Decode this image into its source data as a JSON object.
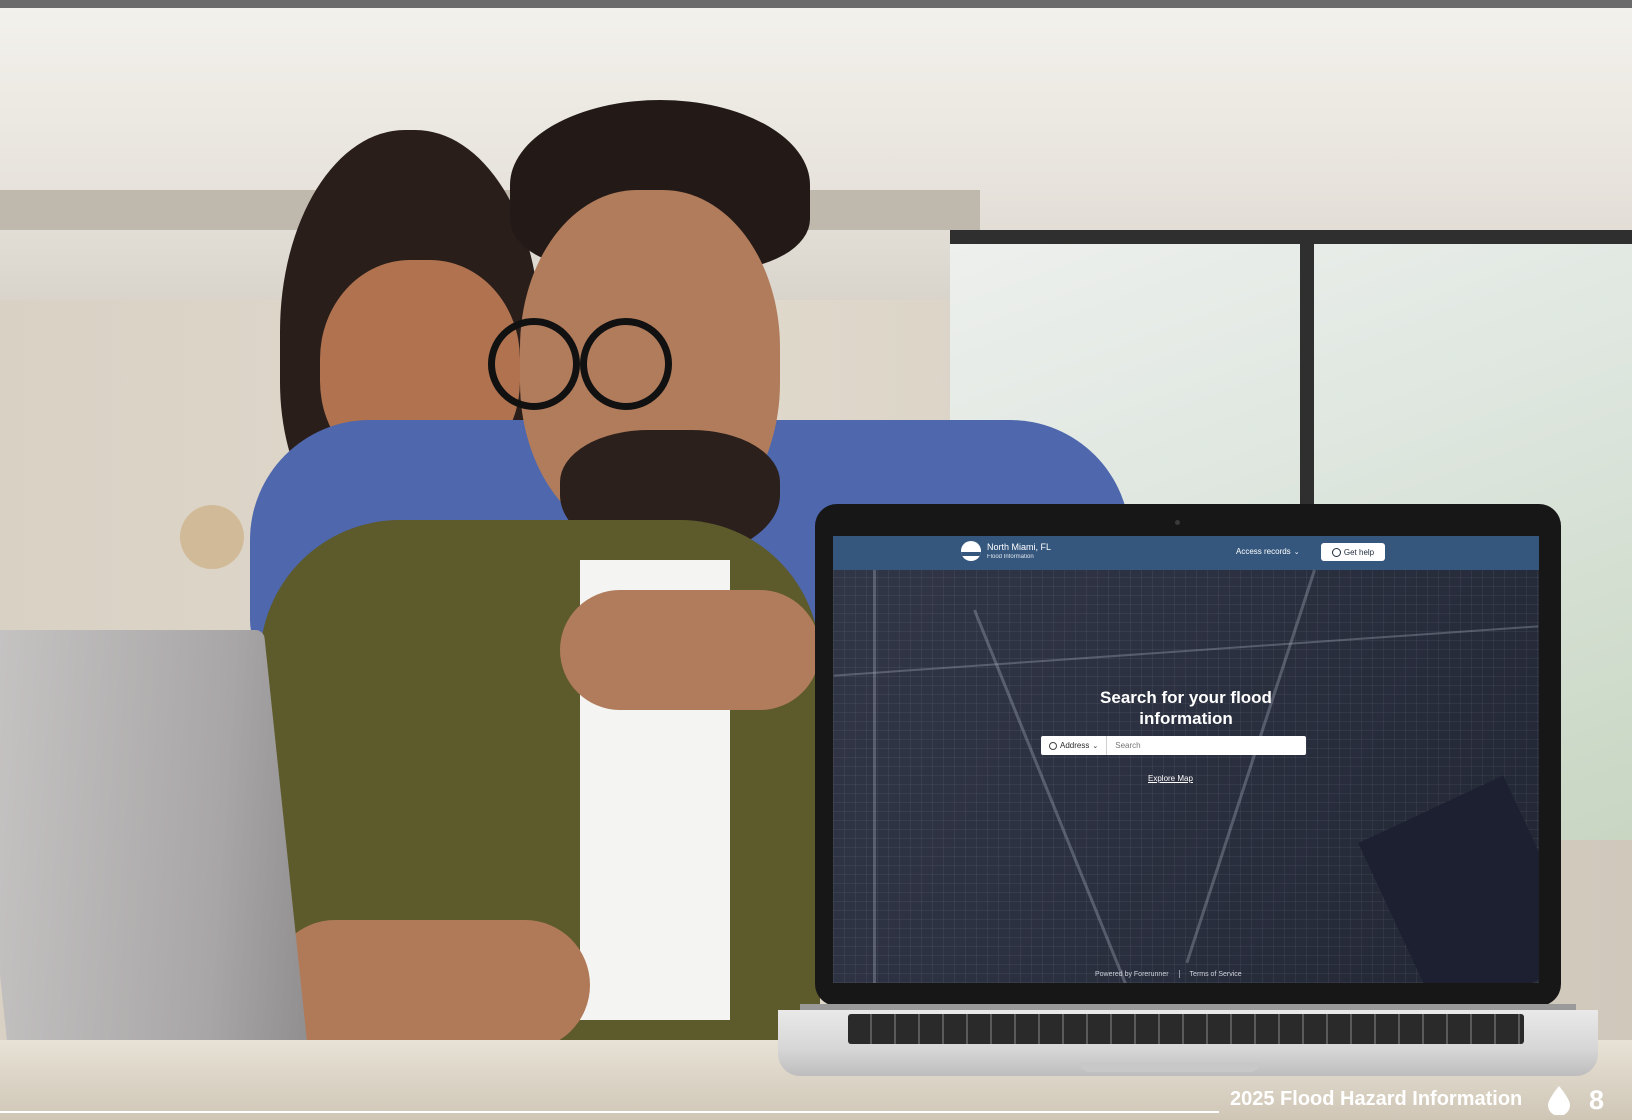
{
  "laptop_app": {
    "brand_name": "North Miami, FL",
    "brand_subtitle": "Flood Information",
    "access_records_label": "Access records",
    "get_help_label": "Get help",
    "headline": "Search for your flood information",
    "search_type": "Address",
    "search_placeholder": "Search",
    "explore_label": "Explore Map",
    "powered_by": "Powered by Forerunner",
    "terms_label": "Terms of Service"
  },
  "page_footer": {
    "title": "2025 Flood Hazard Information",
    "page_number": "8"
  },
  "colors": {
    "header_blue": "#35577e",
    "map_dark": "#2b3142",
    "footer_text": "#ffffff"
  },
  "icons": [
    "search-icon",
    "chevron-down-icon",
    "help-circle-icon",
    "water-drop-icon"
  ]
}
